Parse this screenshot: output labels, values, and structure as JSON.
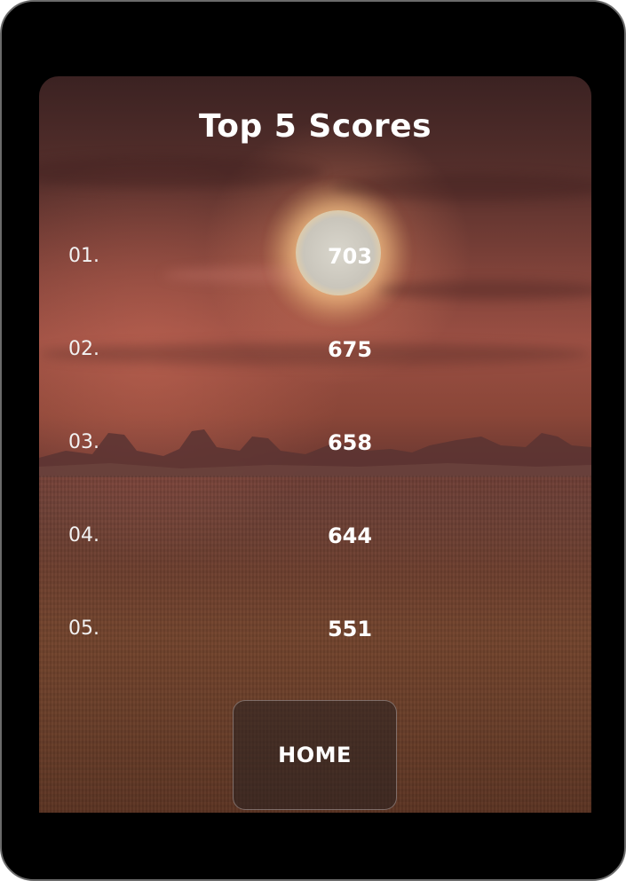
{
  "title": "Top 5 Scores",
  "scores": [
    {
      "rank": "01.",
      "value": "703"
    },
    {
      "rank": "02.",
      "value": "675"
    },
    {
      "rank": "03.",
      "value": "658"
    },
    {
      "rank": "04.",
      "value": "644"
    },
    {
      "rank": "05.",
      "value": "551"
    }
  ],
  "home_button": {
    "label": "HOME"
  },
  "colors": {
    "frame": "#000000",
    "text": "#ffffff",
    "sky_top": "#3b2222",
    "horizon": "#9a4f43",
    "ground": "#6a3f2a",
    "button_bg": "rgba(40,32,32,0.55)"
  }
}
